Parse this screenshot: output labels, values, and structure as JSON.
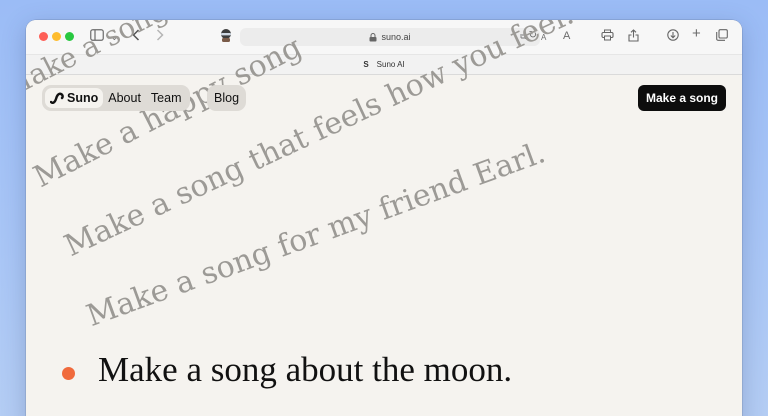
{
  "browser": {
    "url": "suno.ai",
    "tab_title": "Suno AI",
    "tab_favicon": "S",
    "icons": [
      "sidebar-icon",
      "back-icon",
      "forward-icon",
      "privacy-icon",
      "lock-icon",
      "translate-icon",
      "reload-icon",
      "text-smaller-icon",
      "text-larger-icon",
      "print-icon",
      "share-icon",
      "download-icon",
      "new-tab-icon",
      "tabs-overview-icon"
    ],
    "text_small": "A",
    "text_large": "A"
  },
  "nav": {
    "brand": "Suno",
    "about": "About",
    "team": "Team",
    "blog": "Blog",
    "cta": "Make a song"
  },
  "prompts": {
    "p0": "Make a happy song",
    "p0_top": "Make a song",
    "p1": "Make a song that feels how you feel.",
    "p2": "Make a song for my friend Earl.",
    "active": "Make a song about the moon."
  },
  "colors": {
    "accent_dot": "#f06a3c",
    "cta_bg": "#0d0d0d",
    "page_bg": "#f5f3ef",
    "faded_text": "#9c9a96"
  }
}
